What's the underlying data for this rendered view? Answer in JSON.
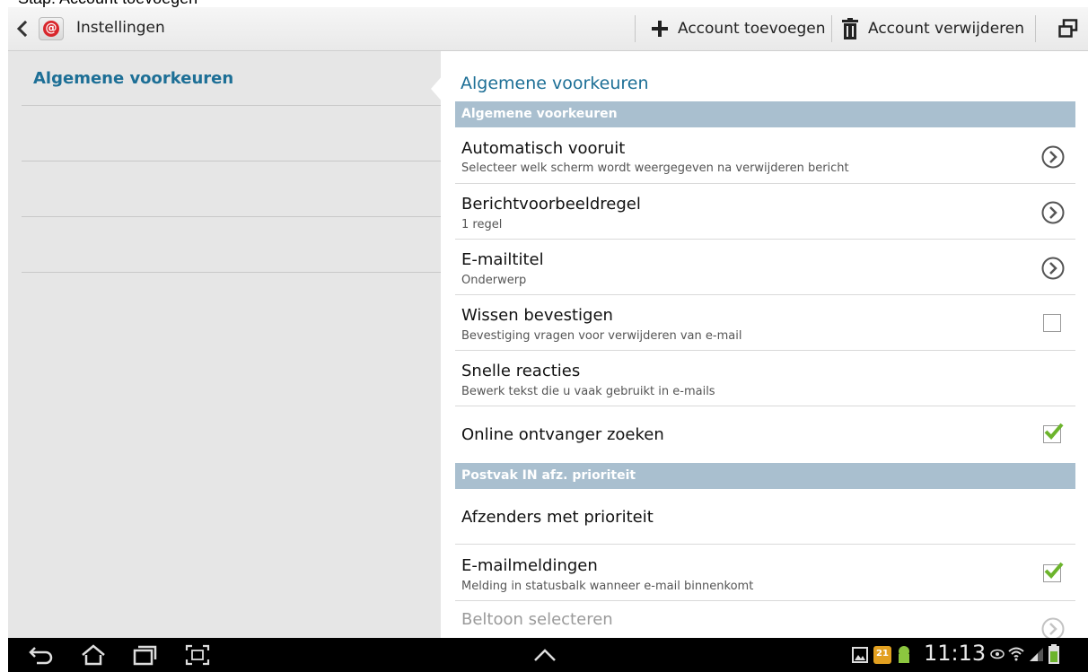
{
  "caption": "Stap: Account toevoegen",
  "action_bar": {
    "title": "Instellingen",
    "add_account": "Account toevoegen",
    "remove_account": "Account verwijderen"
  },
  "left_pane": {
    "items": [
      "Algemene voorkeuren",
      "",
      "",
      ""
    ]
  },
  "right_pane": {
    "title": "Algemene voorkeuren",
    "sections": [
      {
        "header": "Algemene voorkeuren",
        "rows": [
          {
            "title": "Automatisch vooruit",
            "summary": "Selecteer welk scherm wordt weergegeven na verwijderen bericht",
            "control": "chevron"
          },
          {
            "title": "Berichtvoorbeeldregel",
            "summary": "1 regel",
            "control": "chevron"
          },
          {
            "title": "E-mailtitel",
            "summary": "Onderwerp",
            "control": "chevron"
          },
          {
            "title": "Wissen bevestigen",
            "summary": "Bevestiging vragen voor verwijderen van e-mail",
            "control": "checkbox",
            "checked": false
          },
          {
            "title": "Snelle reacties",
            "summary": "Bewerk tekst die u vaak gebruikt in e-mails",
            "control": "none"
          },
          {
            "title": "Online ontvanger zoeken",
            "summary": "",
            "control": "checkbox",
            "checked": true
          }
        ]
      },
      {
        "header": "Postvak IN afz. prioriteit",
        "rows": [
          {
            "title": "Afzenders met prioriteit",
            "summary": "",
            "control": "none"
          },
          {
            "title": "E-mailmeldingen",
            "summary": "Melding in statusbalk wanneer e-mail binnenkomt",
            "control": "checkbox",
            "checked": true
          },
          {
            "title": "Beltoon selecteren",
            "summary": "",
            "control": "chevron",
            "disabled": true
          }
        ]
      }
    ]
  },
  "status_bar": {
    "time": "11:13",
    "notification_badge": "21"
  },
  "icons": {
    "back": "chevron-left-icon",
    "app": "email-app-icon",
    "add": "plus-icon",
    "delete": "trash-icon",
    "window": "multi-window-icon",
    "nav_back": "nav-back-icon",
    "nav_home": "nav-home-icon",
    "nav_recent": "nav-recent-apps-icon",
    "nav_screenshot": "screen-capture-icon",
    "nav_up": "chevron-up-icon"
  },
  "colors": {
    "accent": "#1d6f96",
    "section_header": "#a9bfcf",
    "checkbox_check": "#6cb42c"
  }
}
